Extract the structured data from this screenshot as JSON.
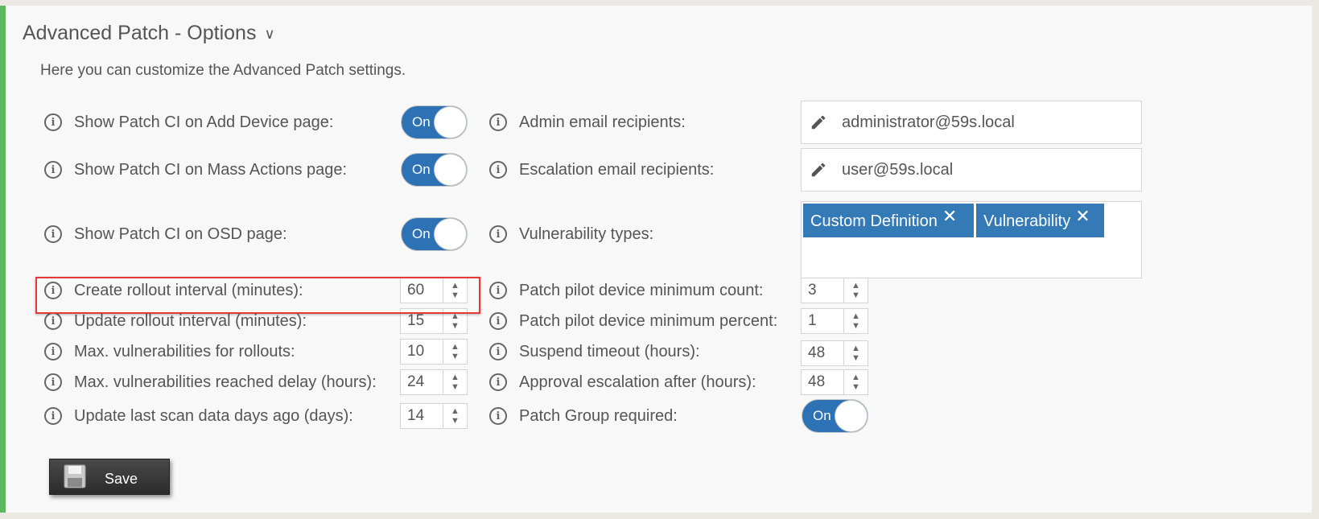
{
  "header": {
    "title": "Advanced Patch - Options"
  },
  "description": "Here you can customize the Advanced Patch settings.",
  "left_toggles": [
    {
      "label": "Show Patch CI on Add Device page:",
      "state": "On"
    },
    {
      "label": "Show Patch CI on Mass Actions page:",
      "state": "On"
    },
    {
      "label": "Show Patch CI on OSD page:",
      "state": "On"
    }
  ],
  "left_numbers": [
    {
      "label": "Create rollout interval (minutes):",
      "value": "60"
    },
    {
      "label": "Update rollout interval (minutes):",
      "value": "15"
    },
    {
      "label": "Max. vulnerabilities for rollouts:",
      "value": "10"
    },
    {
      "label": "Max. vulnerabilities reached delay (hours):",
      "value": "24"
    },
    {
      "label": "Update last scan data days ago (days):",
      "value": "14"
    }
  ],
  "admin_email": {
    "label": "Admin email recipients:",
    "value": "administrator@59s.local"
  },
  "escalation_email": {
    "label": "Escalation email recipients:",
    "value": "user@59s.local"
  },
  "vuln_types": {
    "label": "Vulnerability types:",
    "tags": [
      "Custom Definition",
      "Vulnerability"
    ],
    "remove_glyph": "✕"
  },
  "right_numbers": [
    {
      "label": "Patch pilot device minimum count:",
      "value": "3"
    },
    {
      "label": "Patch pilot device minimum percent:",
      "value": "1"
    },
    {
      "label": "Suspend timeout (hours):",
      "value": "48"
    },
    {
      "label": "Approval escalation after (hours):",
      "value": "48"
    }
  ],
  "patch_group": {
    "label": "Patch Group required:",
    "state": "On"
  },
  "save_label": "Save",
  "colors": {
    "accent": "#5cb85c",
    "toggle_on": "#2d72b5",
    "tag": "#337ab7",
    "highlight": "#e53935"
  }
}
